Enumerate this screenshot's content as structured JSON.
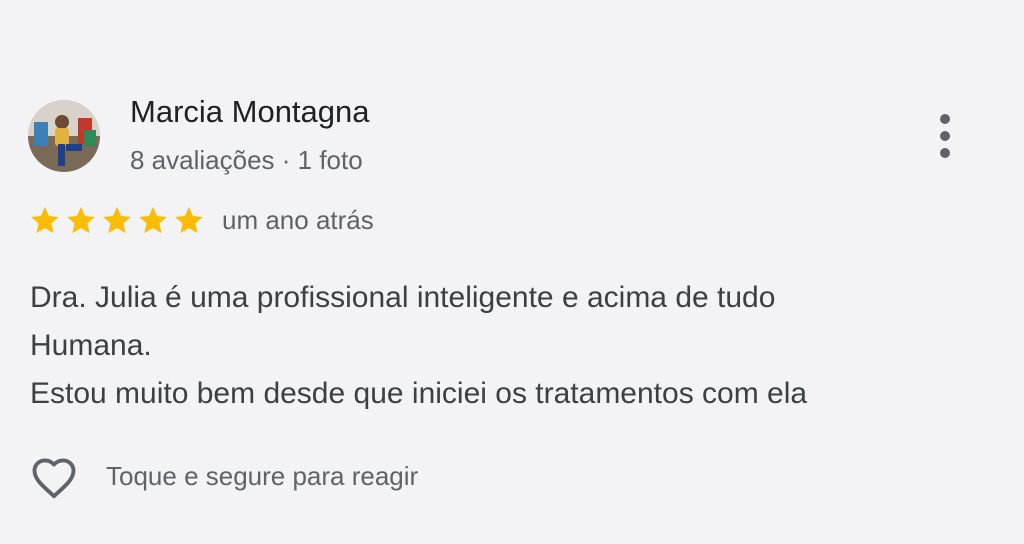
{
  "reviewer": {
    "name": "Marcia Montagna",
    "meta": "8 avaliações · 1 foto"
  },
  "rating": {
    "stars": 5,
    "max": 5,
    "star_color": "#fbbc04",
    "time": "um ano atrás"
  },
  "review": {
    "lines": [
      "Dra. Julia é uma profissional inteligente e acima de tudo",
      "Humana.",
      "Estou muito bem desde que iniciei os tratamentos com ela"
    ]
  },
  "reaction": {
    "icon": "heart-outline-icon",
    "label": "Toque e segure para reagir"
  },
  "menu": {
    "icon": "more-vertical-icon"
  }
}
